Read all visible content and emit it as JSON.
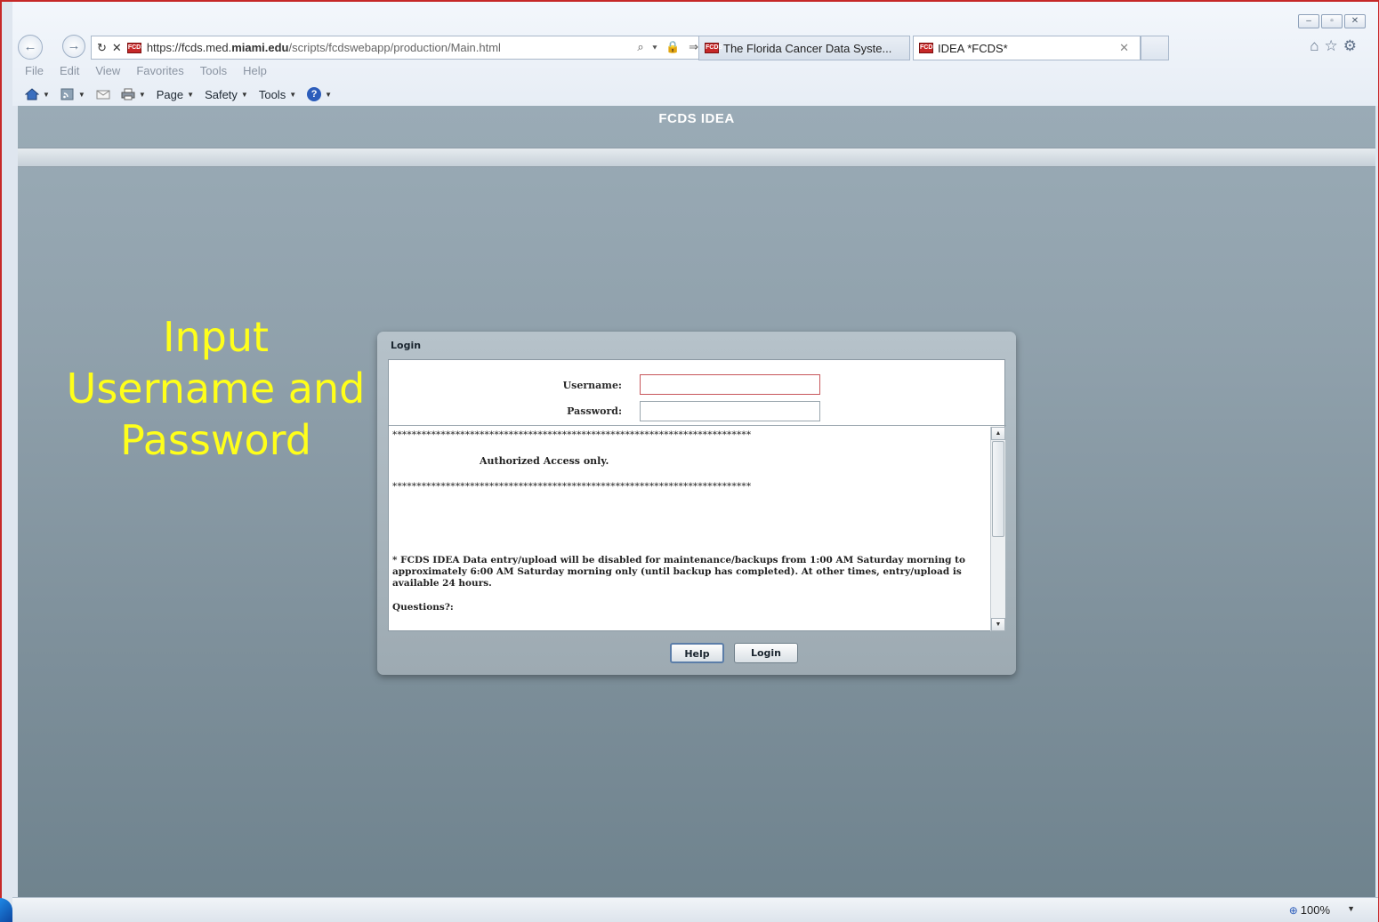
{
  "browser": {
    "url_prefix": "https://fcds.med.",
    "url_domain": "miami.edu",
    "url_path": "/scripts/fcdswebapp/production/Main.html",
    "tabs": [
      {
        "label": "The Florida Cancer Data Syste..."
      },
      {
        "label": "IDEA *FCDS*"
      }
    ],
    "favicon_text": "FCDS",
    "menu": [
      "File",
      "Edit",
      "View",
      "Favorites",
      "Tools",
      "Help"
    ],
    "commands": {
      "page": "Page",
      "safety": "Safety",
      "tools": "Tools"
    },
    "zoom": "100%",
    "glyphs": {
      "back": "←",
      "forward": "→",
      "refresh": "↻",
      "stop": "✕",
      "close_tab": "✕",
      "minimize": "–",
      "restore": "▫",
      "close": "✕",
      "home": "⌂",
      "star": "☆",
      "gear": "⚙",
      "addr_tools": "⌕ ▾ 🔒 ⇒",
      "help": "?"
    }
  },
  "app": {
    "title": "FCDS IDEA",
    "annotation": "Input Username and Password",
    "dialog": {
      "title": "Login",
      "username_label": "Username:",
      "password_label": "Password:",
      "username_value": "",
      "password_value": "",
      "stars": "**************************************************************************",
      "auth_text": "Authorized Access only.",
      "note": "* FCDS IDEA Data entry/upload will be disabled for maintenance/backups from 1:00 AM Saturday morning to approximately 6:00 AM Saturday morning only (until backup has completed). At other times, entry/upload is available 24 hours.",
      "questions": "Questions?:",
      "help_button": "Help",
      "login_button": "Login"
    }
  }
}
